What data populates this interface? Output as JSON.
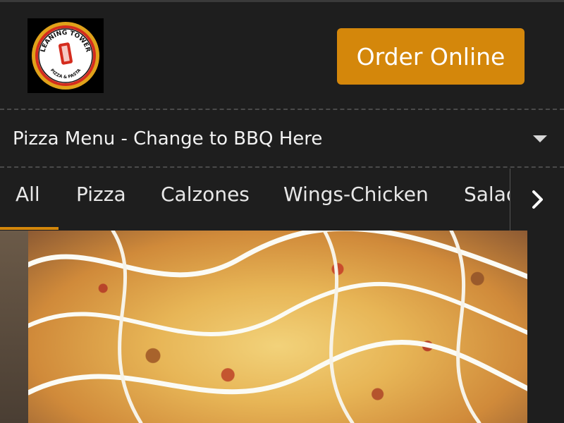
{
  "header": {
    "logo_icon": "leaning-tower-pizza-logo",
    "logo_text_top": "LEANING TOWER",
    "logo_text_bottom": "PIZZA & PASTA",
    "order_button_label": "Order Online"
  },
  "menu_selector": {
    "label": "Pizza Menu - Change to BBQ Here",
    "icon": "caret-down-icon"
  },
  "tabs": {
    "items": [
      {
        "label": "All"
      },
      {
        "label": "Pizza"
      },
      {
        "label": "Calzones"
      },
      {
        "label": "Wings-Chicken"
      },
      {
        "label": "Salads"
      }
    ],
    "active_index": 0,
    "scroll_icon": "chevron-right-icon"
  },
  "hero": {
    "image": "pizza-with-ranch-drizzle-photo"
  },
  "colors": {
    "background": "#1e1e1e",
    "accent": "#d4870b",
    "divider": "#4a4a4a",
    "text": "#f2f2f2"
  }
}
